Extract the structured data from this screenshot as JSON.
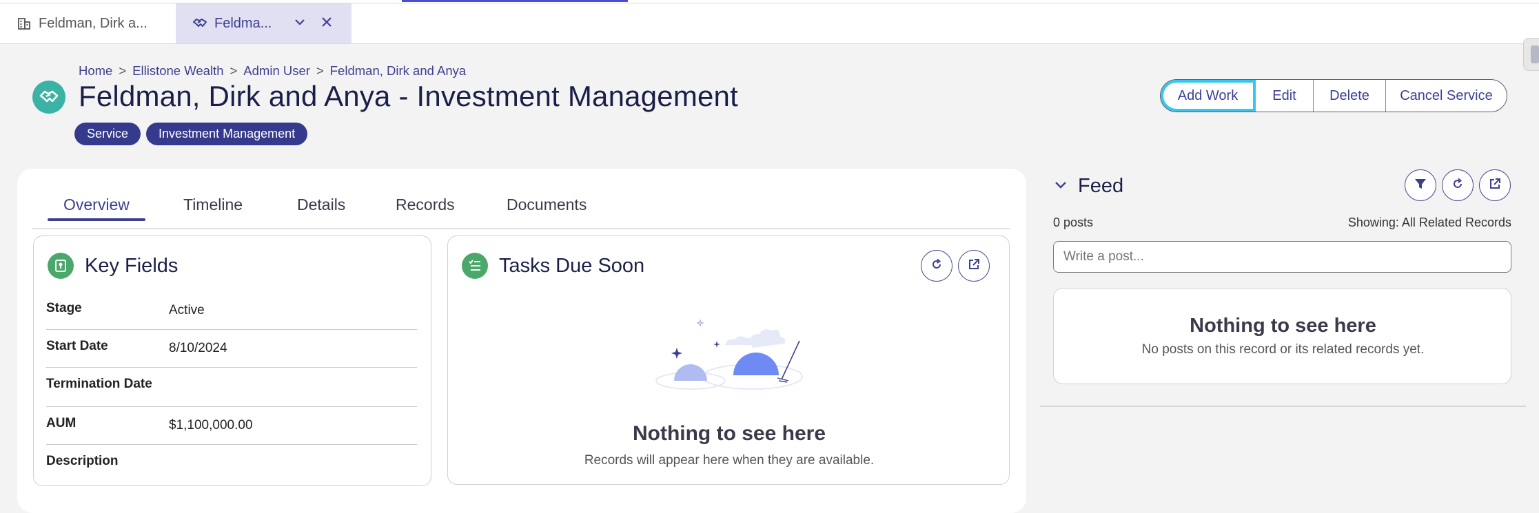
{
  "window_tabs": [
    {
      "label": "Feldman, Dirk a...",
      "icon": "building-icon"
    },
    {
      "label": "Feldma...",
      "icon": "handshake-icon",
      "active": true
    }
  ],
  "breadcrumb": {
    "items": [
      "Home",
      "Ellistone Wealth",
      "Admin User",
      "Feldman, Dirk and Anya"
    ],
    "separator": ">"
  },
  "header": {
    "title": "Feldman, Dirk and Anya - Investment Management",
    "pills": [
      "Service",
      "Investment Management"
    ]
  },
  "actions": {
    "add_work": "Add Work",
    "edit": "Edit",
    "delete": "Delete",
    "cancel_service": "Cancel Service"
  },
  "tabs": [
    "Overview",
    "Timeline",
    "Details",
    "Records",
    "Documents"
  ],
  "key_fields": {
    "title": "Key Fields",
    "rows": [
      {
        "label": "Stage",
        "value": "Active"
      },
      {
        "label": "Start Date",
        "value": "8/10/2024"
      },
      {
        "label": "Termination Date",
        "value": ""
      },
      {
        "label": "AUM",
        "value": "$1,100,000.00"
      },
      {
        "label": "Description",
        "value": ""
      }
    ]
  },
  "tasks": {
    "title": "Tasks Due Soon",
    "empty_title": "Nothing to see here",
    "empty_sub": "Records will appear here when they are available."
  },
  "feed": {
    "title": "Feed",
    "posts": "0 posts",
    "showing": "Showing: All Related Records",
    "input_placeholder": "Write a post...",
    "empty_title": "Nothing to see here",
    "empty_sub": "No posts on this record or its related records yet."
  },
  "colors": {
    "accent": "#3d3f8e",
    "pill": "#363a8c",
    "hero_icon": "#3bb3a4",
    "card_icon": "#4aa86a",
    "focus_ring": "#37c6ee"
  }
}
